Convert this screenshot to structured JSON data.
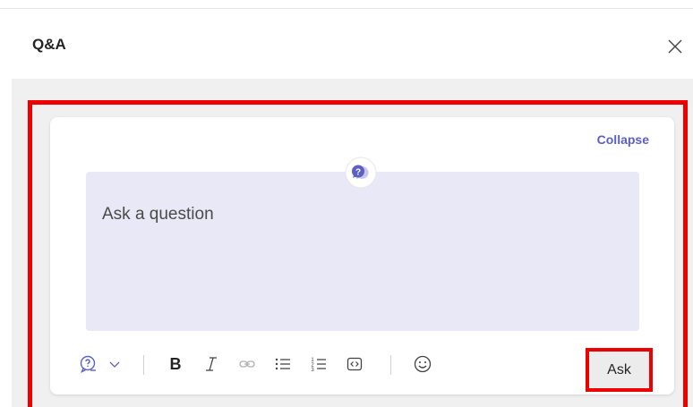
{
  "header": {
    "title": "Q&A"
  },
  "card": {
    "collapse_label": "Collapse",
    "placeholder": "Ask a question"
  },
  "toolbar": {
    "items": [
      "question-type-icon",
      "chevron-down-icon",
      "bold-icon",
      "italic-icon",
      "link-icon",
      "bulleted-list-icon",
      "numbered-list-icon",
      "code-snippet-icon",
      "emoji-icon"
    ],
    "ask_label": "Ask"
  },
  "colors": {
    "accent": "#5b5fc7",
    "highlight": "#ee0000",
    "editor_bg": "#e8e8f6",
    "panel_bg": "#f0f0f0"
  }
}
